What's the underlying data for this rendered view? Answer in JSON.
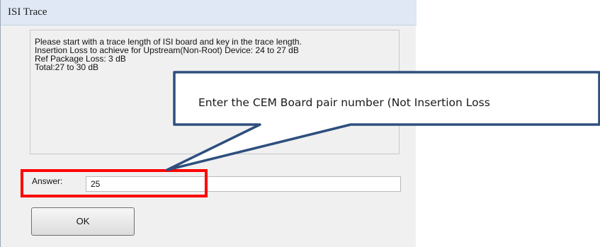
{
  "window": {
    "title": "ISI Trace"
  },
  "message": {
    "lines": [
      "Please start with a trace length of ISI board and key in the trace length.",
      "Insertion Loss to achieve for Upstream(Non-Root) Device: 24 to 27 dB",
      "Ref Package Loss: 3 dB",
      "Total:27 to 30 dB"
    ]
  },
  "answer": {
    "label": "Answer:",
    "value": "25"
  },
  "buttons": {
    "ok_label": "OK"
  },
  "callout": {
    "text": "Enter the CEM Board pair number (Not Insertion Loss"
  },
  "colors": {
    "highlight": "#ff0000",
    "callout_border": "#2e4f7e",
    "titlebar": "#dfe8f4"
  }
}
